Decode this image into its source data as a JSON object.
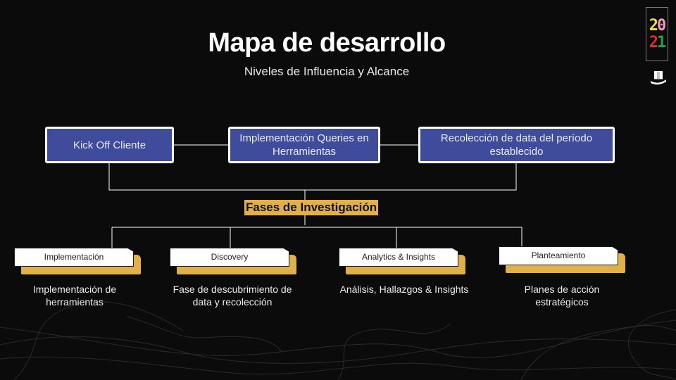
{
  "header": {
    "title": "Mapa de desarrollo",
    "subtitle": "Niveles de Influencia y Alcance"
  },
  "logo": {
    "digits": [
      "2",
      "0",
      "2",
      "1"
    ],
    "digit_colors": [
      "#f2e03a",
      "#f29bc3",
      "#e52b2b",
      "#1fa34a"
    ],
    "icon": "top-hat-icon"
  },
  "top_steps": [
    {
      "label": "Kick Off Cliente"
    },
    {
      "label": "Implementación Queries en Herramientas"
    },
    {
      "label": "Recolección de data del período establecido"
    }
  ],
  "hub": {
    "label": "Fases de Investigación"
  },
  "phases": [
    {
      "label": "Implementación",
      "description": "Implementación de herramientas"
    },
    {
      "label": "Discovery",
      "description": "Fase de descubrimiento de data y recolección"
    },
    {
      "label": "Analytics & Insights",
      "description": "Análisis, Hallazgos & Insights"
    },
    {
      "label": "Planteamiento",
      "description": "Planes de acción estratégicos"
    }
  ],
  "colors": {
    "background": "#0b0b0b",
    "top_box_fill": "#3f4b9b",
    "accent_gold": "#e2b04a",
    "line": "#ffffff"
  }
}
